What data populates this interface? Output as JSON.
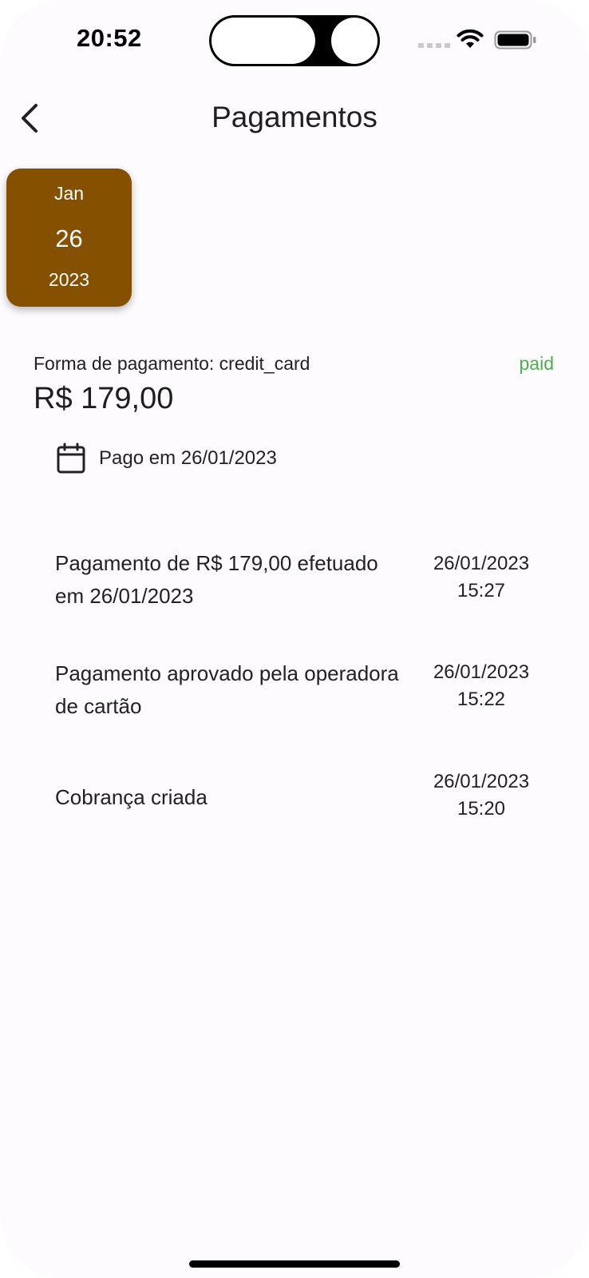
{
  "status_bar": {
    "time": "20:52"
  },
  "header": {
    "title": "Pagamentos",
    "back_icon": "chevron-left-icon"
  },
  "date_card": {
    "month": "Jan",
    "day": "26",
    "year": "2023",
    "color": "#855000"
  },
  "payment": {
    "method_label": "Forma de pagamento: credit_card",
    "status": "paid",
    "status_color": "#4caf50",
    "amount": "R$ 179,00",
    "paid_on": "Pago em 26/01/2023",
    "calendar_icon": "calendar-icon"
  },
  "events": [
    {
      "description": "Pagamento de R$ 179,00 efetuado em 26/01/2023",
      "date": "26/01/2023",
      "time": "15:27"
    },
    {
      "description": "Pagamento aprovado pela operadora de cartão",
      "date": "26/01/2023",
      "time": "15:22"
    },
    {
      "description": "Cobrança criada",
      "date": "26/01/2023",
      "time": "15:20"
    }
  ]
}
